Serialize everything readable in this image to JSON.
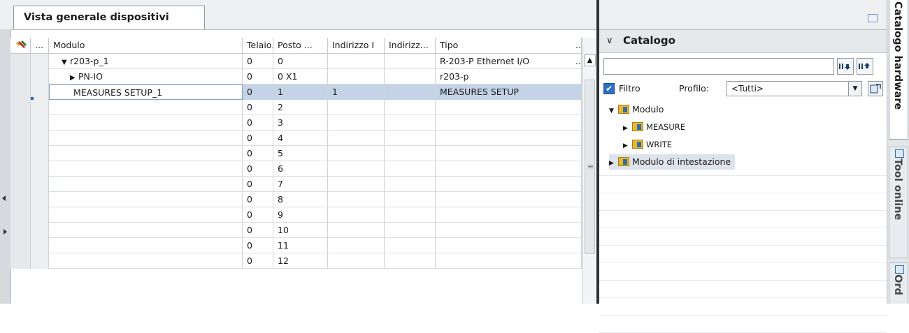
{
  "device_overview": {
    "tab_label": "Vista generale dispositivi",
    "columns": [
      "...",
      "Modulo",
      "Telaio...",
      "Posto ...",
      "Indirizzo I",
      "Indirizz...",
      "Tipo",
      ".."
    ],
    "rows": [
      {
        "module": "r203-p_1",
        "expander": "▼",
        "rack": "0",
        "slot": "0",
        "in_addr": "",
        "out_addr": "",
        "type": "R-203-P Ethernet I/O",
        "extra": ".."
      },
      {
        "module": "PN-IO",
        "expander": "▶",
        "rack": "0",
        "slot": "0 X1",
        "in_addr": "",
        "out_addr": "",
        "type": "r203-p",
        "extra": ""
      },
      {
        "module": "MEASURES SETUP_1",
        "expander": "",
        "rack": "0",
        "slot": "1",
        "in_addr": "1",
        "out_addr": "",
        "type": "MEASURES SETUP",
        "extra": "",
        "selected": true
      },
      {
        "module": "",
        "expander": "",
        "rack": "0",
        "slot": "2",
        "in_addr": "",
        "out_addr": "",
        "type": "",
        "extra": ""
      },
      {
        "module": "",
        "expander": "",
        "rack": "0",
        "slot": "3",
        "in_addr": "",
        "out_addr": "",
        "type": "",
        "extra": ""
      },
      {
        "module": "",
        "expander": "",
        "rack": "0",
        "slot": "4",
        "in_addr": "",
        "out_addr": "",
        "type": "",
        "extra": ""
      },
      {
        "module": "",
        "expander": "",
        "rack": "0",
        "slot": "5",
        "in_addr": "",
        "out_addr": "",
        "type": "",
        "extra": ""
      },
      {
        "module": "",
        "expander": "",
        "rack": "0",
        "slot": "6",
        "in_addr": "",
        "out_addr": "",
        "type": "",
        "extra": ""
      },
      {
        "module": "",
        "expander": "",
        "rack": "0",
        "slot": "7",
        "in_addr": "",
        "out_addr": "",
        "type": "",
        "extra": ""
      },
      {
        "module": "",
        "expander": "",
        "rack": "0",
        "slot": "8",
        "in_addr": "",
        "out_addr": "",
        "type": "",
        "extra": ""
      },
      {
        "module": "",
        "expander": "",
        "rack": "0",
        "slot": "9",
        "in_addr": "",
        "out_addr": "",
        "type": "",
        "extra": ""
      },
      {
        "module": "",
        "expander": "",
        "rack": "0",
        "slot": "10",
        "in_addr": "",
        "out_addr": "",
        "type": "",
        "extra": ""
      },
      {
        "module": "",
        "expander": "",
        "rack": "0",
        "slot": "11",
        "in_addr": "",
        "out_addr": "",
        "type": "",
        "extra": ""
      },
      {
        "module": "",
        "expander": "",
        "rack": "0",
        "slot": "12",
        "in_addr": "",
        "out_addr": "",
        "type": "",
        "extra": ""
      }
    ]
  },
  "catalog": {
    "title": "Catalogo",
    "search_value": "",
    "search_down_icon": "search-down-icon",
    "search_up_icon": "search-up-icon",
    "filter_label": "Filtro",
    "filter_checked": true,
    "profile_label": "Profilo:",
    "profile_value": "<Tutti>",
    "tree": [
      {
        "label": "Modulo",
        "expander": "▼",
        "level": 0
      },
      {
        "label": "MEASURE",
        "expander": "▶",
        "level": 1
      },
      {
        "label": "WRITE",
        "expander": "▶",
        "level": 1
      },
      {
        "label": "Modulo di intestazione",
        "expander": "▶",
        "level": 0,
        "highlighted": true
      }
    ]
  },
  "side_tabs": [
    "Catalogo hardware",
    "Tool online",
    "Ord"
  ],
  "colors": {
    "selection": "#c4d3e6",
    "accent": "#2f6fc2",
    "folder": "#e8b731"
  }
}
